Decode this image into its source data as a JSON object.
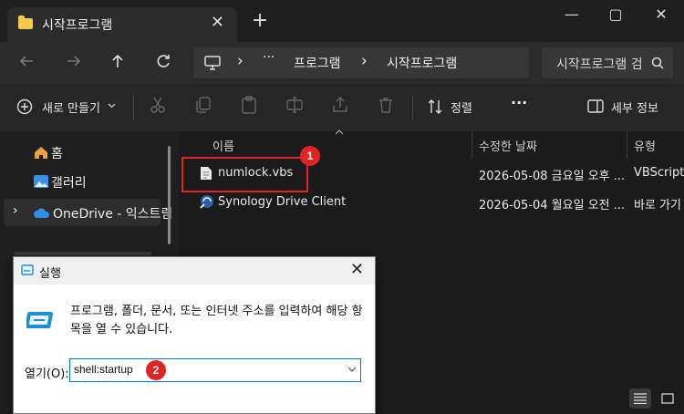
{
  "window": {
    "tab_title": "시작프로그램",
    "new_tab": "+",
    "tab_close": "✕",
    "minimize": "—",
    "maximize": "▢",
    "close": "✕"
  },
  "nav": {
    "more": "···",
    "breadcrumb": [
      "프로그램",
      "시작프로그램"
    ],
    "chevron": "›",
    "search_placeholder": "시작프로그램 검색"
  },
  "toolbar": {
    "new_label": "새로 만들기",
    "sort_label": "정렬",
    "more": "···",
    "details_label": "세부 정보"
  },
  "sidebar": {
    "items": [
      {
        "label": "홈",
        "icon": "home-icon"
      },
      {
        "label": "갤러리",
        "icon": "gallery-icon"
      },
      {
        "label": "OneDrive - 익스트림",
        "icon": "onedrive-icon"
      }
    ]
  },
  "list": {
    "columns": [
      "이름",
      "수정한 날짜",
      "유형"
    ],
    "rows": [
      {
        "name": "numlock.vbs",
        "date": "2026-05-08 금요일 오후 ...",
        "type": "VBScript ..."
      },
      {
        "name": "Synology Drive Client",
        "date": "2026-05-04 월요일 오전 ...",
        "type": "바로 가기"
      }
    ]
  },
  "run_dialog": {
    "title": "실행",
    "message": "프로그램, 폴더, 문서, 또는 인터넷 주소를 입력하여 해당 항목을 열 수 있습니다.",
    "open_label": "열기(O):",
    "input_value": "shell:startup"
  },
  "annotations": {
    "badge1": "1",
    "badge2": "2",
    "color": "#e02424"
  }
}
